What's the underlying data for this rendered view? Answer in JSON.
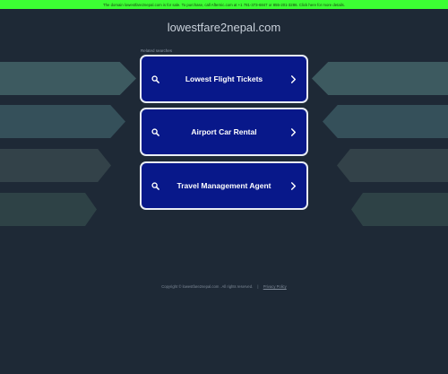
{
  "banner": {
    "text": "The domain lowestfare2nepal.com is for sale. To purchase, call Afternic.com at +1 781-373-6847 or 855-201-3286. Click here for more details."
  },
  "header": {
    "domain": "lowestfare2nepal.com"
  },
  "related_searches": {
    "heading": "Related searches",
    "items": [
      {
        "label": "Lowest Flight Tickets"
      },
      {
        "label": "Airport Car Rental"
      },
      {
        "label": "Travel Management Agent"
      }
    ]
  },
  "footer": {
    "copyright": "Copyright © lowestfare2nepal.com . All rights reserved.",
    "separator": "|",
    "privacy": "Privacy Policy"
  },
  "colors": {
    "background": "#1e2936",
    "banner": "#3cff33",
    "button_fill": "#08188a",
    "button_border": "#e8ecf4"
  },
  "icons": {
    "search": "search-icon",
    "chevron": "chevron-right-icon"
  }
}
